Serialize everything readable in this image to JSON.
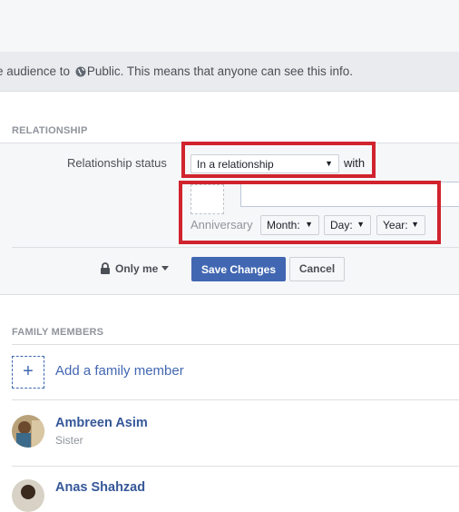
{
  "notice": {
    "before": "e audience to",
    "audience": "Public",
    "after": ". This means that anyone can see this info."
  },
  "relationship": {
    "heading": "RELATIONSHIP",
    "status_label": "Relationship status",
    "status_value": "In a relationship",
    "with_label": "with",
    "with_value": "",
    "anniversary_label": "Anniversary",
    "month": "Month:",
    "day": "Day:",
    "year": "Year:",
    "privacy": "Only me",
    "save": "Save Changes",
    "cancel": "Cancel"
  },
  "family": {
    "heading": "FAMILY MEMBERS",
    "add_label": "Add a family member",
    "members": [
      {
        "name": "Ambreen Asim",
        "relation": "Sister"
      },
      {
        "name": "Anas Shahzad",
        "relation": ""
      }
    ]
  },
  "colors": {
    "accent": "#4267b2",
    "link": "#365899",
    "highlight": "#d0232e"
  }
}
